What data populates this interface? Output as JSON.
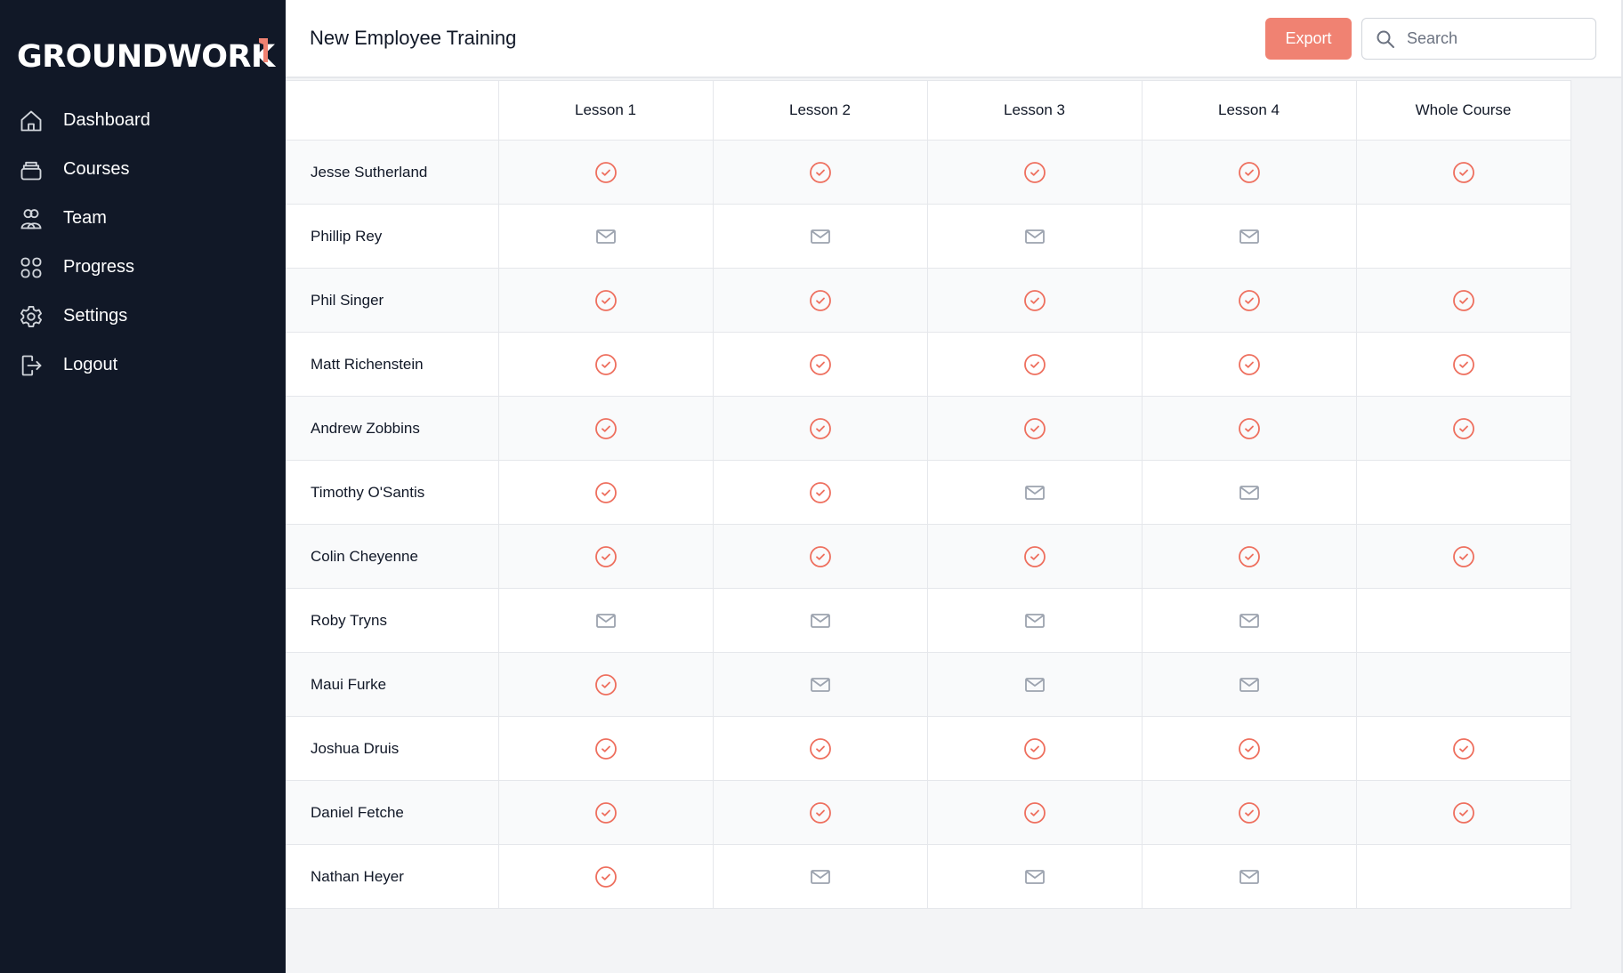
{
  "brand": {
    "name": "GROUNDWORK",
    "accent": "#f08272",
    "sidebar_bg": "#111827"
  },
  "sidebar": {
    "items": [
      {
        "label": "Dashboard",
        "icon": "home-icon"
      },
      {
        "label": "Courses",
        "icon": "courses-icon"
      },
      {
        "label": "Team",
        "icon": "team-icon"
      },
      {
        "label": "Progress",
        "icon": "grid-icon"
      },
      {
        "label": "Settings",
        "icon": "gear-icon"
      },
      {
        "label": "Logout",
        "icon": "logout-icon"
      }
    ]
  },
  "header": {
    "title": "New Employee Training",
    "export_label": "Export",
    "search_placeholder": "Search",
    "search_value": ""
  },
  "table": {
    "columns": [
      "",
      "Lesson 1",
      "Lesson 2",
      "Lesson 3",
      "Lesson 4",
      "Whole Course"
    ],
    "status_legend": {
      "done": "check-circle-icon",
      "sent": "mail-icon",
      "none": ""
    },
    "rows": [
      {
        "name": "Jesse Sutherland",
        "cells": [
          "done",
          "done",
          "done",
          "done",
          "done"
        ]
      },
      {
        "name": "Phillip Rey",
        "cells": [
          "sent",
          "sent",
          "sent",
          "sent",
          "none"
        ]
      },
      {
        "name": "Phil Singer",
        "cells": [
          "done",
          "done",
          "done",
          "done",
          "done"
        ]
      },
      {
        "name": "Matt Richenstein",
        "cells": [
          "done",
          "done",
          "done",
          "done",
          "done"
        ]
      },
      {
        "name": "Andrew Zobbins",
        "cells": [
          "done",
          "done",
          "done",
          "done",
          "done"
        ]
      },
      {
        "name": "Timothy O'Santis",
        "cells": [
          "done",
          "done",
          "sent",
          "sent",
          "none"
        ]
      },
      {
        "name": "Colin Cheyenne",
        "cells": [
          "done",
          "done",
          "done",
          "done",
          "done"
        ]
      },
      {
        "name": "Roby Tryns",
        "cells": [
          "sent",
          "sent",
          "sent",
          "sent",
          "none"
        ]
      },
      {
        "name": "Maui Furke",
        "cells": [
          "done",
          "sent",
          "sent",
          "sent",
          "none"
        ]
      },
      {
        "name": "Joshua Druis",
        "cells": [
          "done",
          "done",
          "done",
          "done",
          "done"
        ]
      },
      {
        "name": "Daniel Fetche",
        "cells": [
          "done",
          "done",
          "done",
          "done",
          "done"
        ]
      },
      {
        "name": "Nathan Heyer",
        "cells": [
          "done",
          "sent",
          "sent",
          "sent",
          "none"
        ]
      }
    ]
  }
}
